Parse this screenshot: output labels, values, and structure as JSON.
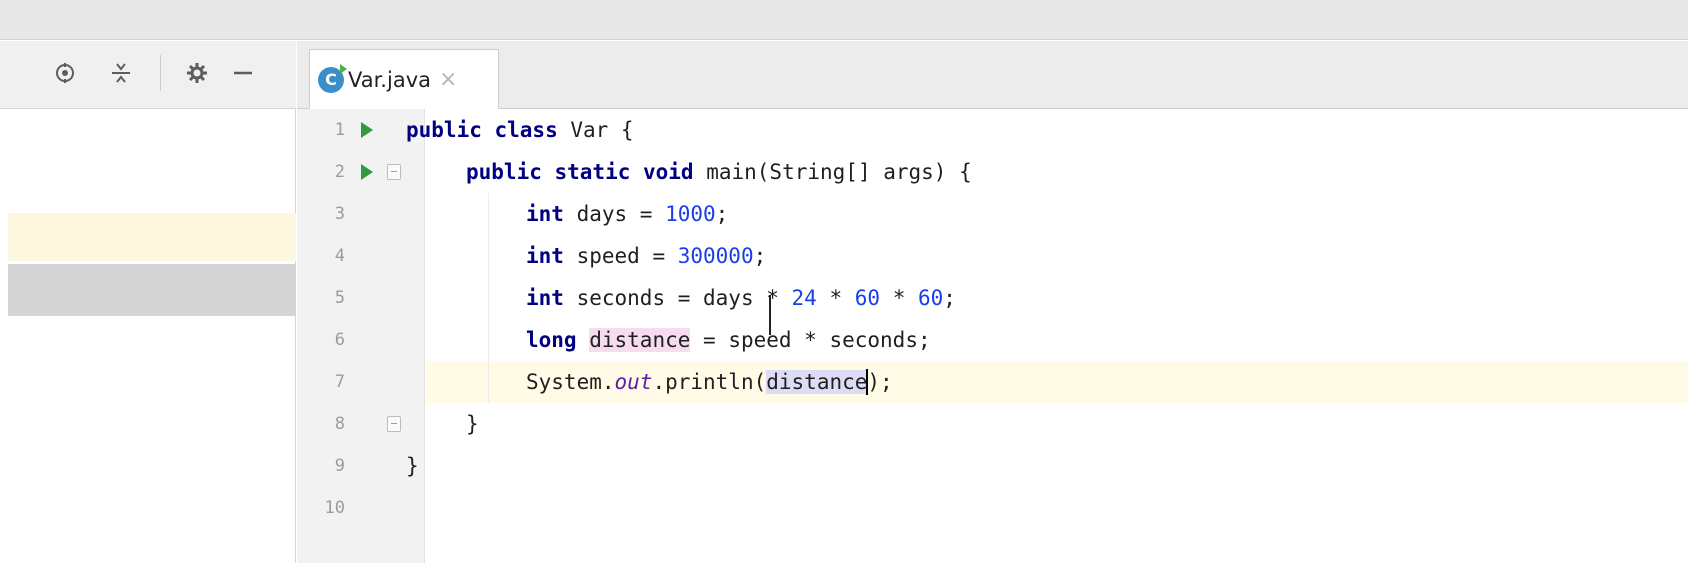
{
  "toolbar": {
    "icons": [
      "crosshair-icon",
      "collapse-all-icon",
      "gear-icon",
      "minimize-icon"
    ]
  },
  "tab": {
    "icon_letter": "C",
    "filename": "Var.java",
    "close": "×"
  },
  "gutter": {
    "line_numbers": [
      "1",
      "2",
      "3",
      "4",
      "5",
      "6",
      "7",
      "8",
      "9",
      "10"
    ]
  },
  "code": {
    "l1_kw": "public class",
    "l1_rest": " Var {",
    "l2_kw": "public static void",
    "l2_rest": " main(String[] args) {",
    "l3_kw": "int",
    "l3_a": " days = ",
    "l3_num": "1000",
    "l3_end": ";",
    "l4_kw": "int",
    "l4_a": " speed = ",
    "l4_num": "300000",
    "l4_end": ";",
    "l5_kw": "int",
    "l5_a": " seconds = days * ",
    "l5_n1": "24",
    "l5_b": " * ",
    "l5_n2": "60",
    "l5_c": " * ",
    "l5_n3": "60",
    "l5_end": ";",
    "l6_kw": "long",
    "l6_var": "distance",
    "l6_rest": " = speed * seconds;",
    "l7_a": "System.",
    "l7_field": "out",
    "l7_b": ".println(",
    "l7_var": "distance",
    "l7_end": ");",
    "l8": "}",
    "l9": "}"
  }
}
